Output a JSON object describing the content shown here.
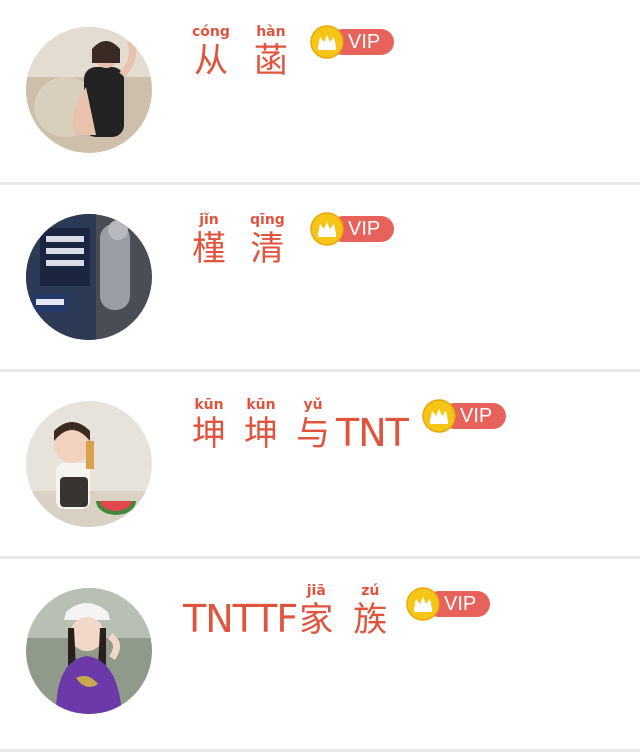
{
  "users": [
    {
      "name_parts": [
        {
          "pinyin": "cóng",
          "char": "从"
        },
        {
          "pinyin": "hàn",
          "char": "菡"
        }
      ],
      "badge": "VIP",
      "badge_icon": "crown-icon"
    },
    {
      "name_parts": [
        {
          "pinyin": "jǐn",
          "char": "槿"
        },
        {
          "pinyin": "qīng",
          "char": "清"
        }
      ],
      "badge": "VIP",
      "badge_icon": "crown-icon"
    },
    {
      "name_parts": [
        {
          "pinyin": "kūn",
          "char": "坤"
        },
        {
          "pinyin": "kūn",
          "char": "坤"
        },
        {
          "pinyin": "yǔ",
          "char": "与"
        }
      ],
      "name_suffix": "TNT",
      "badge": "VIP",
      "badge_icon": "crown-icon"
    },
    {
      "name_prefix": "TNTTF",
      "name_parts": [
        {
          "pinyin": "jiā",
          "char": "家"
        },
        {
          "pinyin": "zú",
          "char": "族"
        }
      ],
      "badge": "VIP",
      "badge_icon": "crown-icon"
    }
  ],
  "colors": {
    "name_accent": "#e0533c",
    "vip_pill": "#e6625a",
    "crown_coin": "#f5c518",
    "divider": "#e9e9e9"
  }
}
